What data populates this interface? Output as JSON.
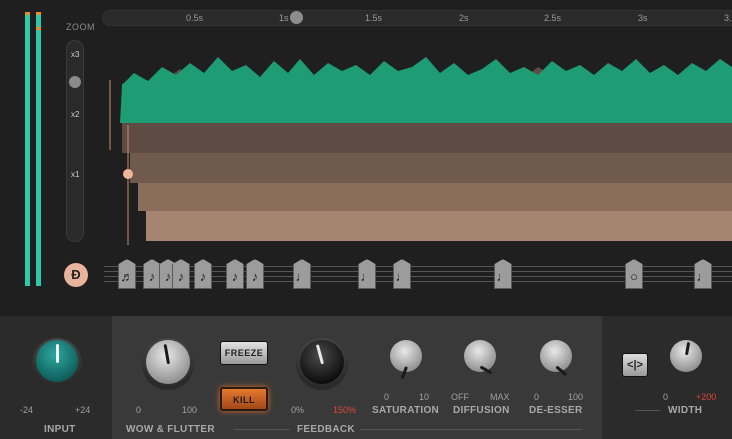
{
  "zoom": {
    "title": "ZOOM",
    "levels": [
      "x3",
      "x2",
      "x1"
    ]
  },
  "timeline": {
    "labels": [
      "0.5s",
      "1s",
      "1.5s",
      "2s",
      "2.5s",
      "3s",
      "3."
    ]
  },
  "notes": {
    "count": 15
  },
  "controls": {
    "input": {
      "label": "INPUT",
      "min": "-24",
      "max": "+24"
    },
    "wow": {
      "label": "WOW & FLUTTER",
      "min": "0",
      "max": "100"
    },
    "freeze": {
      "label": "FREEZE"
    },
    "kill": {
      "label": "KILL"
    },
    "feedback": {
      "label": "FEEDBACK",
      "min": "0%",
      "max": "150%"
    },
    "saturation": {
      "label": "SATURATION",
      "min": "0",
      "max": "10"
    },
    "diffusion": {
      "label": "DIFFUSION",
      "min": "OFF",
      "max": "MAX"
    },
    "deesser": {
      "label": "DE-ESSER",
      "min": "0",
      "max": "100"
    },
    "width": {
      "label": "WIDTH",
      "min": "0",
      "max": "+200"
    },
    "swap_icon": "stereo-swap-icon"
  },
  "colors": {
    "meter": "#2fc8a8",
    "green_wave": "#1e9c74",
    "brown_wave": "#a07862",
    "accent": "#e07030"
  }
}
